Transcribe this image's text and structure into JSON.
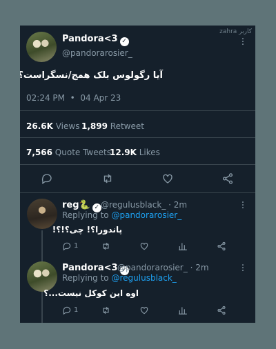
{
  "watermark": "zahra كاربر",
  "main_tweet": {
    "name": "Pandora<3",
    "handle": "@pandorarosier_",
    "text": "آیا رگولوس بلک همج/نسگراست؟",
    "time": "02:24 PM",
    "sep": "•",
    "date": "04 Apr 23",
    "views_count": "26.6K",
    "views_label": "Views",
    "retweet_count": "1,899",
    "retweet_label": "Retweet",
    "quote_count": "7,566",
    "quote_label": "Quote Tweets",
    "likes_count": "12.9K",
    "likes_label": "Likes"
  },
  "replies": [
    {
      "name": "reg",
      "handle": "@regulusblack_",
      "age": "· 2m",
      "replying_prefix": "Replying to",
      "replying_to": "@pandorarosier_",
      "text": "پاندورا؟! چی؟!؟!",
      "reply_count": "1"
    },
    {
      "name": "Pandora<3",
      "handle": "@pandorarosier_",
      "age": "· 2m",
      "replying_prefix": "Replying to",
      "replying_to": "@regulusblack_",
      "text": "اوه این کوکل نیست...؟",
      "reply_count": "1"
    }
  ],
  "icons": [
    "reply-icon",
    "retweet-icon",
    "like-icon",
    "share-icon",
    "views-icon",
    "more-icon",
    "verified-icon",
    "snake-emoji-icon"
  ]
}
